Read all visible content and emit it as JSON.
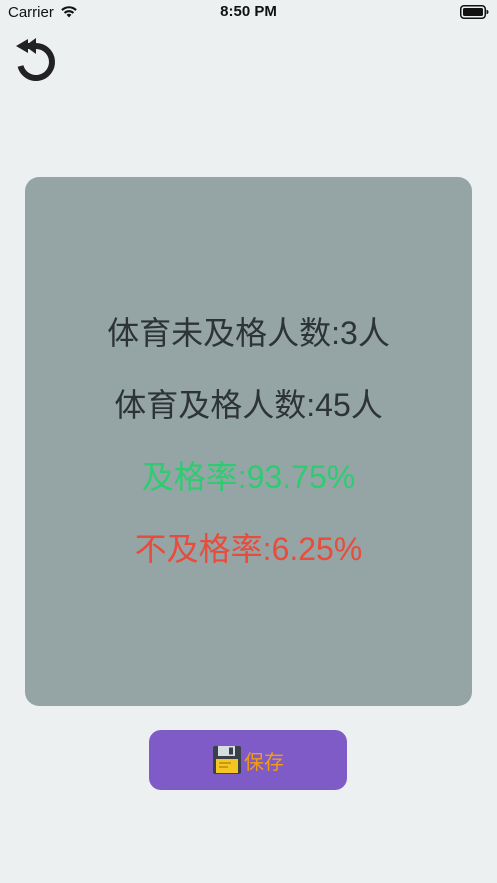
{
  "status_bar": {
    "carrier": "Carrier",
    "time": "8:50 PM"
  },
  "stats": {
    "pe_failed_count": "体育未及格人数:3人",
    "pe_passed_count": "体育及格人数:45人",
    "pass_rate": "及格率:93.75%",
    "fail_rate": "不及格率:6.25%"
  },
  "actions": {
    "save_label": "保存"
  },
  "icons": {
    "back": "undo-arrow-icon",
    "save": "floppy-disk-icon",
    "wifi": "wifi-icon",
    "battery": "battery-icon"
  },
  "colors": {
    "background": "#ecf0f1",
    "card": "#95a5a6",
    "text_dark": "#2d3436",
    "pass_green": "#2ecc71",
    "fail_red": "#e74c3c",
    "button_purple": "#7e5bc6",
    "button_text_orange": "#f39c12"
  }
}
